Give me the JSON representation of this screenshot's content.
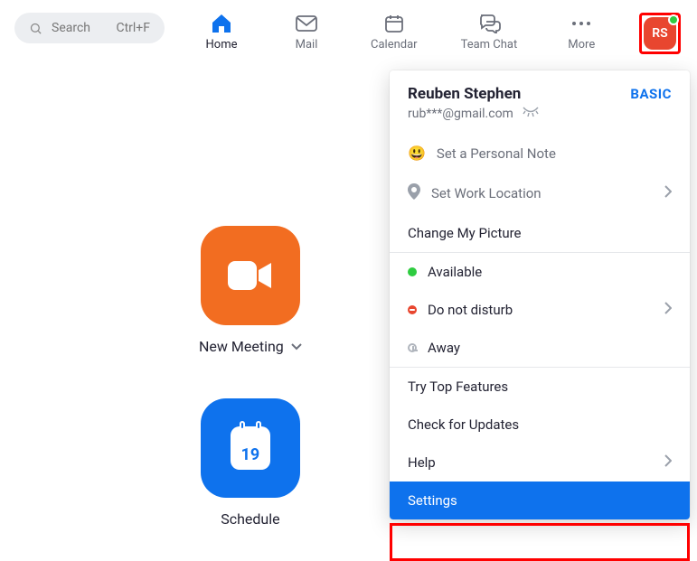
{
  "search": {
    "placeholder": "Search",
    "hotkey": "Ctrl+F"
  },
  "tabs": {
    "home": "Home",
    "mail": "Mail",
    "calendar": "Calendar",
    "teamchat": "Team Chat",
    "more": "More"
  },
  "avatar": {
    "initials": "RS"
  },
  "tiles": {
    "new_meeting": "New Meeting",
    "schedule": "Schedule",
    "schedule_date": "19"
  },
  "dropdown": {
    "name": "Reuben Stephen",
    "plan": "BASIC",
    "email": "rub***@gmail.com",
    "personal_note": "Set a Personal Note",
    "work_location": "Set Work Location",
    "change_picture": "Change My Picture",
    "status_available": "Available",
    "status_dnd": "Do not disturb",
    "status_away": "Away",
    "top_features": "Try Top Features",
    "check_updates": "Check for Updates",
    "help": "Help",
    "settings": "Settings"
  }
}
